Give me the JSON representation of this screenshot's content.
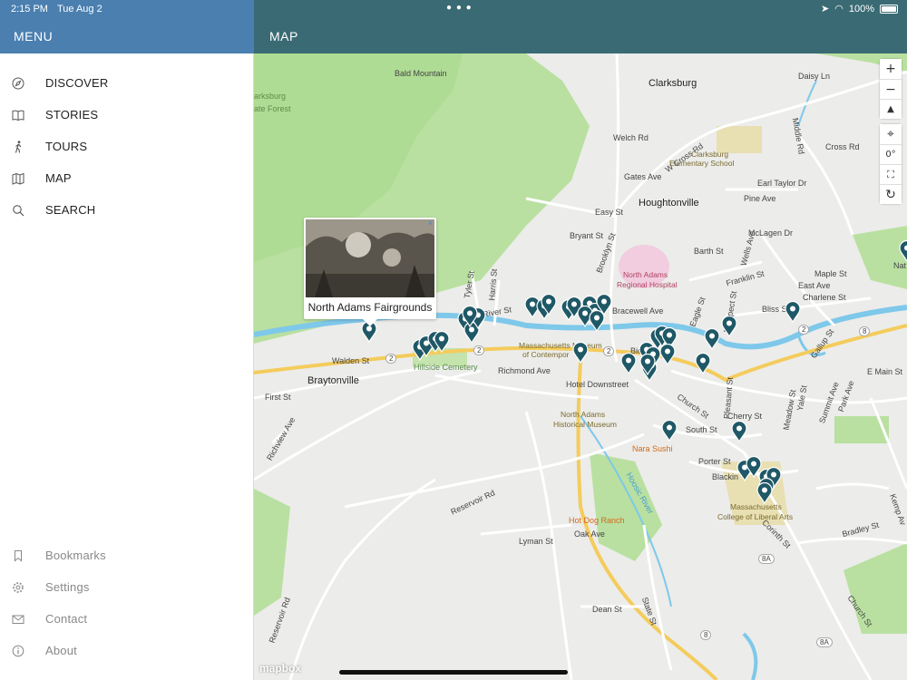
{
  "status": {
    "time": "2:15 PM",
    "date": "Tue Aug 2",
    "battery": "100%"
  },
  "sidebar": {
    "title": "MENU",
    "items": [
      {
        "label": "DISCOVER",
        "icon": "compass-icon"
      },
      {
        "label": "STORIES",
        "icon": "book-icon"
      },
      {
        "label": "TOURS",
        "icon": "walking-icon"
      },
      {
        "label": "MAP",
        "icon": "map-icon"
      },
      {
        "label": "SEARCH",
        "icon": "search-icon"
      }
    ],
    "secondary": [
      {
        "label": "Bookmarks",
        "icon": "bookmark-icon"
      },
      {
        "label": "Settings",
        "icon": "gear-icon"
      },
      {
        "label": "Contact",
        "icon": "mail-icon"
      },
      {
        "label": "About",
        "icon": "info-icon"
      }
    ]
  },
  "map": {
    "title": "MAP",
    "popup_title": "North Adams Fairgrounds",
    "popup_close": "×",
    "attribution": "mapbox",
    "compass_reading": "0°",
    "labels": {
      "bald_mountain": "Bald Mountain",
      "clarksburg_forest_1": "arksburg",
      "clarksburg_forest_2": "ate Forest",
      "clarksburg": "Clarksburg",
      "welch_rd": "Welch Rd",
      "w_cross_rd": "W Cross Rd",
      "clarksburg_school_1": "Clarksburg",
      "clarksburg_school_2": "Elementary School",
      "gates_ave": "Gates Ave",
      "earl_taylor_dr": "Earl Taylor Dr",
      "pine_ave": "Pine Ave",
      "cross_rd": "Cross Rd",
      "middle_rd": "Middle Rd",
      "daisy_ln": "Daisy Ln",
      "houghtonville": "Houghtonville",
      "easy_st": "Easy St",
      "bryant_st": "Bryant St",
      "brooklyn_st": "Brooklyn St",
      "barth_st": "Barth St",
      "mclagen_dr": "McLagen Dr",
      "franklin_st": "Franklin St",
      "maple_st": "Maple St",
      "east_ave": "East Ave",
      "charlene_st": "Charlene St",
      "hospital_1": "North Adams",
      "hospital_2": "Regional Hospital",
      "nat": "Nat",
      "river_st": "River St",
      "bracewell_ave": "Bracewell Ave",
      "bliss_st": "Bliss St",
      "mass_moca_1": "Massachusetts Museum",
      "mass_moca_2": "of Contempor",
      "walden_st": "Walden St",
      "braytonville": "Braytonville",
      "hillside_cemetery": "Hillside Cemetery",
      "richmond_ave": "Richmond Ave",
      "hotel_downstreet": "Hotel Downstreet",
      "first_st": "First St",
      "gallup_st": "Gallup St",
      "e_main_st": "E Main St",
      "church_st": "Church St",
      "cherry_st": "Cherry St",
      "meadow_st": "Meadow St",
      "summit_ave": "Summit Ave",
      "park_ave": "Park Ave",
      "south_st": "South St",
      "historical_museum_1": "North Adams",
      "historical_museum_2": "Historical Museum",
      "nara_sushi": "Nara Sushi",
      "porter_st": "Porter St",
      "blackinton": "Blackin",
      "mcla_1": "Massachusetts",
      "mcla_2": "College of Liberal Arts",
      "reservoir_rd": "Reservoir Rd",
      "hot_dog_ranch": "Hot Dog Ranch",
      "hoosic_river": "Hoosic River",
      "lyman_st": "Lyman St",
      "oak_ave": "Oak Ave",
      "corinth_st": "Corinth St",
      "bradley_st": "Bradley St",
      "kemp_ave": "Kemp Av",
      "dean_st": "Dean St",
      "state_st": "State St",
      "reservoir_rd_2": "Reservoir Rd",
      "tyler_st": "Tyler St",
      "harris_st": "Harris St",
      "wells_ave": "Wells Ave",
      "eagle_st": "Eagle St",
      "prospect_st": "Prospect St",
      "yale_st": "Yale St",
      "richview_ave": "Richview Ave",
      "pleasant_st": "Pleasant St",
      "bic": "Bic",
      "route_2": "2",
      "route_8": "8",
      "route_8a": "8A"
    }
  }
}
